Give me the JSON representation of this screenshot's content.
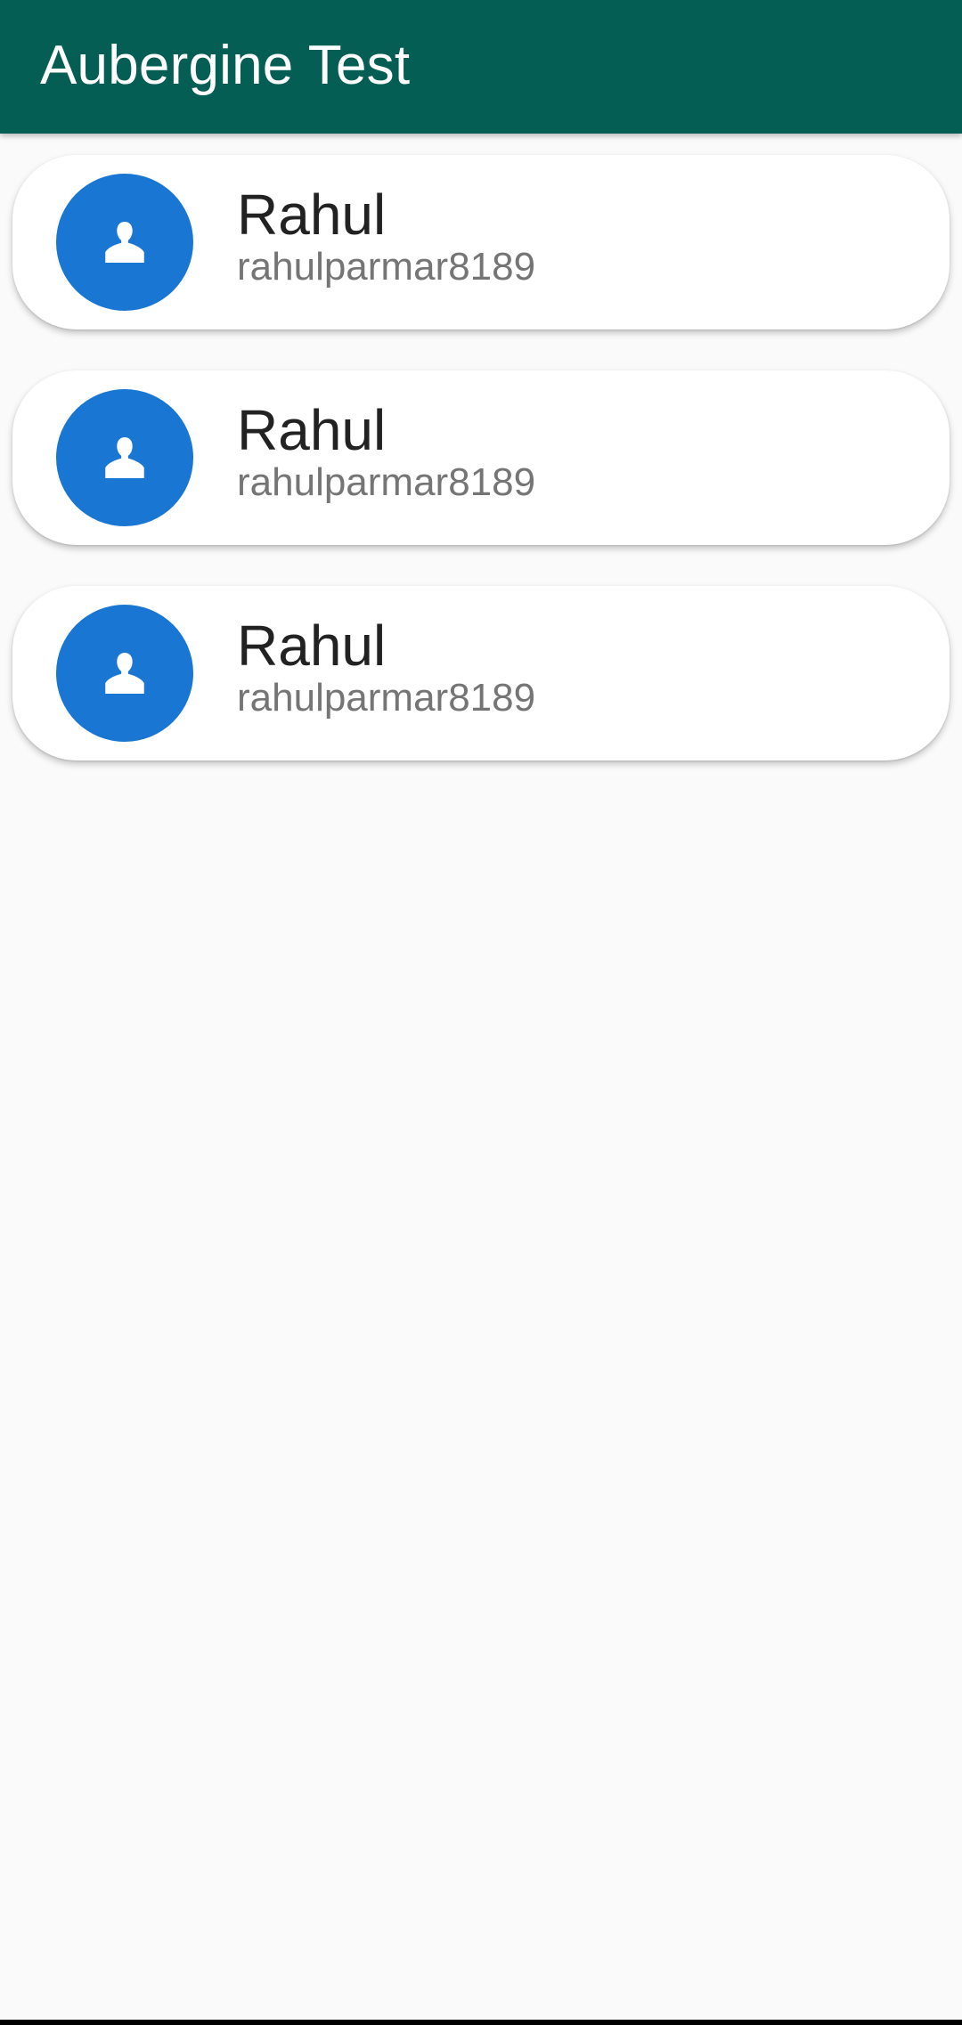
{
  "app_bar": {
    "title": "Aubergine Test",
    "color": "#045e54"
  },
  "users": [
    {
      "name": "Rahul",
      "username": "rahulparmar8189",
      "avatar_icon": "person-icon"
    },
    {
      "name": "Rahul",
      "username": "rahulparmar8189",
      "avatar_icon": "person-icon"
    },
    {
      "name": "Rahul",
      "username": "rahulparmar8189",
      "avatar_icon": "person-icon"
    }
  ],
  "colors": {
    "background": "#fafafa",
    "avatar": "#1976d2",
    "name_text": "#222222",
    "username_text": "#757575"
  }
}
